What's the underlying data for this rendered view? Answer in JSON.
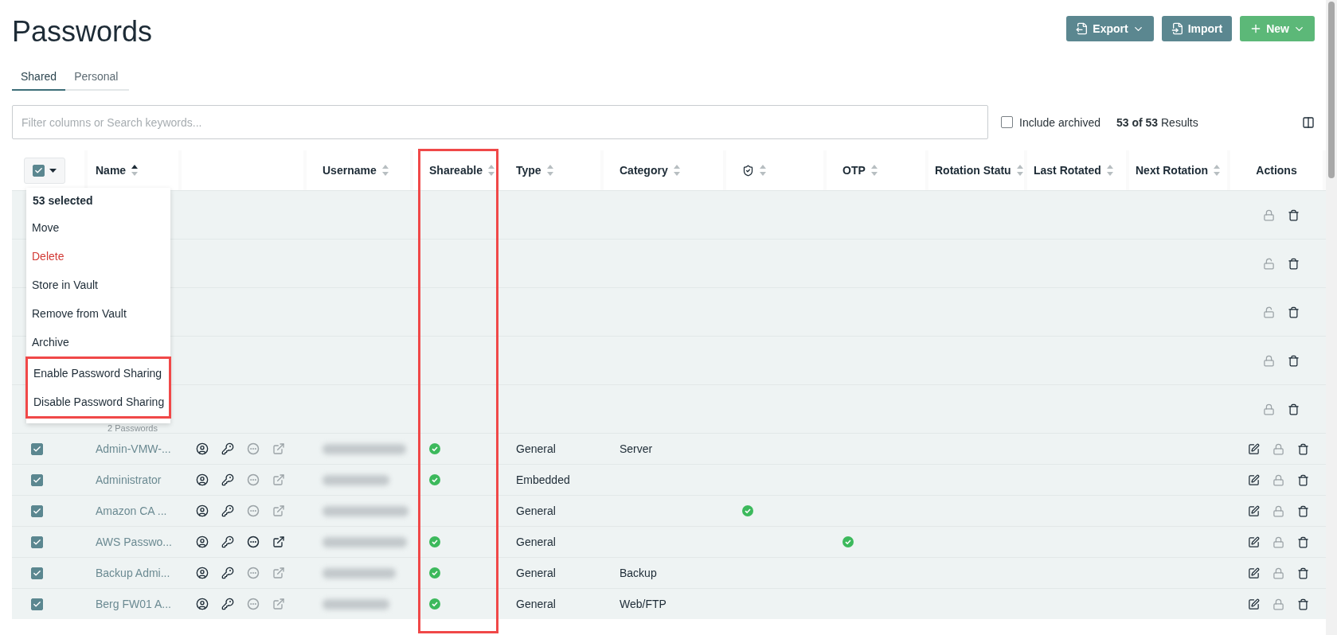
{
  "page": {
    "title": "Passwords"
  },
  "actions": [
    {
      "label": "Export",
      "kind": "export"
    },
    {
      "label": "Import",
      "kind": "import"
    },
    {
      "label": "New",
      "kind": "new"
    }
  ],
  "tabs": [
    {
      "label": "Shared",
      "selected": true
    },
    {
      "label": "Personal",
      "selected": false
    }
  ],
  "search": {
    "placeholder": "Filter columns or Search keywords..."
  },
  "include_archived": {
    "label": "Include archived",
    "checked": false
  },
  "results": "**53 of 53** Results",
  "table": {
    "select_all": {
      "checked": true
    },
    "columns": [
      {
        "kind": "text",
        "label": "Name",
        "sorted": true
      },
      {
        "kind": "blank"
      },
      {
        "kind": "text",
        "label": "Username",
        "sorted": false
      },
      {
        "kind": "text",
        "label": "Shareable",
        "sorted": false,
        "highlighted": true
      },
      {
        "kind": "text",
        "label": "Type",
        "sorted": false
      },
      {
        "kind": "text",
        "label": "Category",
        "sorted": false
      },
      {
        "kind": "shield",
        "sorted": false
      },
      {
        "kind": "text",
        "label": "OTP",
        "sorted": false
      },
      {
        "kind": "text",
        "label": "Rotation Statu",
        "sorted": false
      },
      {
        "kind": "text",
        "label": "Last Rotated",
        "sorted": false
      },
      {
        "kind": "text",
        "label": "Next Rotation",
        "sorted": false
      },
      {
        "kind": "actions",
        "label": "Actions"
      }
    ],
    "groups": [
      {
        "locked": true
      },
      {
        "locked": false
      },
      {
        "locked": false
      },
      {
        "locked": true
      },
      {
        "locked": true,
        "subtitle": "2 Passwords"
      }
    ],
    "rows": [
      {
        "checked": true,
        "name": "Admin-VMW-...",
        "otp_enabled": false,
        "shareable": true,
        "type": "General",
        "category": "Server",
        "shield": false,
        "otp": false
      },
      {
        "checked": true,
        "name": "Administrator",
        "otp_enabled": false,
        "shareable": true,
        "type": "Embedded",
        "shield": false,
        "otp": false
      },
      {
        "checked": true,
        "name": "Amazon CA ...",
        "otp_enabled": false,
        "shareable": false,
        "type": "General",
        "shield": true,
        "otp": false
      },
      {
        "checked": true,
        "name": "AWS Passwo...",
        "otp_enabled": true,
        "shareable": true,
        "type": "General",
        "shield": false,
        "otp": true
      },
      {
        "checked": true,
        "name": "Backup Admi...",
        "otp_enabled": false,
        "shareable": true,
        "type": "General",
        "category": "Backup",
        "shield": false,
        "otp": false
      },
      {
        "checked": true,
        "name": "Berg FW01 A...",
        "otp_enabled": false,
        "shareable": true,
        "type": "General",
        "category": "Web/FTP",
        "shield": false,
        "otp": false
      }
    ]
  },
  "bulk_menu": {
    "title": "53 selected",
    "items": [
      {
        "label": "Move",
        "kind": "normal",
        "highlighted": false
      },
      {
        "label": "Delete",
        "kind": "danger",
        "highlighted": false
      },
      {
        "label": "Store in Vault",
        "kind": "normal",
        "highlighted": false
      },
      {
        "label": "Remove from Vault",
        "kind": "normal",
        "highlighted": false
      },
      {
        "label": "Archive",
        "kind": "normal",
        "highlighted": false
      },
      {
        "label": "Enable Password Sharing",
        "kind": "normal",
        "highlighted": true
      },
      {
        "label": "Disable Password Sharing",
        "kind": "normal",
        "highlighted": true
      }
    ]
  }
}
